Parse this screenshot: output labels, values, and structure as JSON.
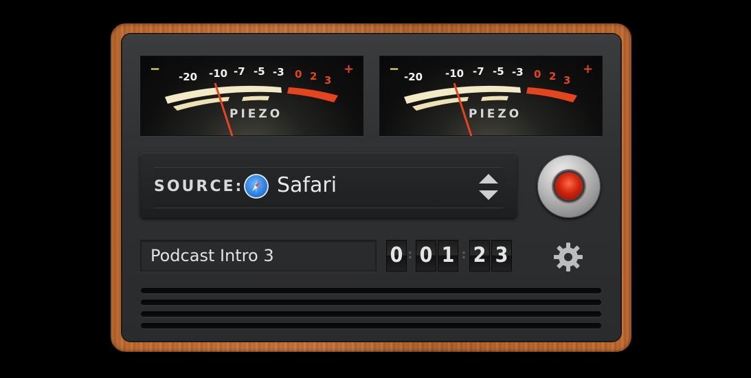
{
  "meters": {
    "left": {
      "minus": "−",
      "plus": "+",
      "scale": [
        "-20",
        "-10",
        "-7",
        "-5",
        "-3",
        "0",
        "2",
        "3"
      ],
      "brand": "PIEZO"
    },
    "right": {
      "minus": "−",
      "plus": "+",
      "scale": [
        "-20",
        "-10",
        "-7",
        "-5",
        "-3",
        "0",
        "2",
        "3"
      ],
      "brand": "PIEZO"
    }
  },
  "source": {
    "label": "SOURCE:",
    "value": "Safari",
    "icon": "safari-icon"
  },
  "recording": {
    "name": "Podcast Intro 3",
    "time_digits": [
      "0",
      "0",
      "1",
      "2",
      "3"
    ],
    "time_separators": [
      ":",
      ":"
    ]
  },
  "colors": {
    "wood": "#b5632e",
    "panel": "#2e2f31",
    "meter_cream": "#f3ebc8",
    "meter_red": "#e5451c",
    "record_led": "#d1250e"
  }
}
